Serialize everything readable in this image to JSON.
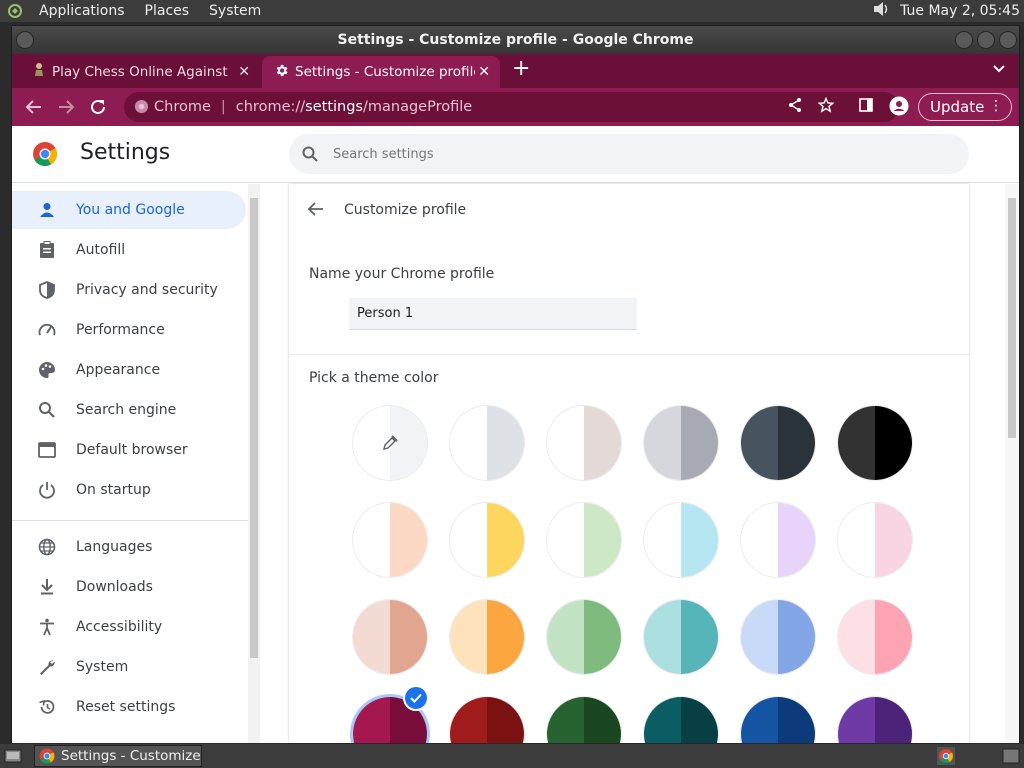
{
  "panel": {
    "menus": [
      "Applications",
      "Places",
      "System"
    ],
    "clock": "Tue May  2, 05:45"
  },
  "window": {
    "title": "Settings - Customize profile - Google Chrome"
  },
  "tabs": [
    {
      "title": "Play Chess Online Against the Computer",
      "active": false
    },
    {
      "title": "Settings - Customize profile",
      "active": true
    }
  ],
  "toolbar": {
    "omnibox_chrome": "Chrome",
    "omnibox_sep": "|",
    "url_scheme": "chrome://",
    "url_host": "settings",
    "url_path": "/manageProfile",
    "update_label": "Update"
  },
  "settings": {
    "title": "Settings",
    "search_placeholder": "Search settings",
    "nav": [
      {
        "label": "You and Google",
        "icon": "person-icon",
        "active": true
      },
      {
        "label": "Autofill",
        "icon": "clipboard-icon"
      },
      {
        "label": "Privacy and security",
        "icon": "shield-icon"
      },
      {
        "label": "Performance",
        "icon": "speedometer-icon"
      },
      {
        "label": "Appearance",
        "icon": "palette-icon"
      },
      {
        "label": "Search engine",
        "icon": "search-icon"
      },
      {
        "label": "Default browser",
        "icon": "browser-icon"
      },
      {
        "label": "On startup",
        "icon": "power-icon"
      },
      {
        "label": "Languages",
        "icon": "globe-icon"
      },
      {
        "label": "Downloads",
        "icon": "download-icon"
      },
      {
        "label": "Accessibility",
        "icon": "accessibility-icon"
      },
      {
        "label": "System",
        "icon": "wrench-icon"
      },
      {
        "label": "Reset settings",
        "icon": "restore-icon"
      }
    ]
  },
  "customize": {
    "title": "Customize profile",
    "name_label": "Name your Chrome profile",
    "name_value": "Person 1",
    "theme_label": "Pick a theme color",
    "swatches": [
      [
        [
          "#ffffff",
          "#f1f3f4"
        ],
        [
          "#ffffff",
          "#dee1e6"
        ],
        [
          "#ffffff",
          "#e3d9d7"
        ],
        [
          "#d6d7dc",
          "#a8aab3"
        ],
        [
          "#47535e",
          "#2a323a"
        ],
        [
          "#323232",
          "#000000"
        ]
      ],
      [
        [
          "#ffffff",
          "#fcd9c4"
        ],
        [
          "#ffffff",
          "#fdd65f"
        ],
        [
          "#ffffff",
          "#cde8c4"
        ],
        [
          "#ffffff",
          "#b6e6f1"
        ],
        [
          "#ffffff",
          "#e8d3fb"
        ],
        [
          "#ffffff",
          "#f9d4e3"
        ]
      ],
      [
        [
          "#f3dbd3",
          "#e2a590"
        ],
        [
          "#fde2bb",
          "#fca63f"
        ],
        [
          "#c3e4c4",
          "#7fbb7f"
        ],
        [
          "#acdfe0",
          "#56b5b9"
        ],
        [
          "#c9daf8",
          "#83a6e6"
        ],
        [
          "#fde0e5",
          "#fca4b4"
        ]
      ],
      [
        [
          "#a5174f",
          "#7a0e3b"
        ],
        [
          "#a01c1c",
          "#7a1212"
        ],
        [
          "#276231",
          "#1a4622"
        ],
        [
          "#0a5d63",
          "#073f44"
        ],
        [
          "#1655a3",
          "#0d3a7a"
        ],
        [
          "#6f3aa6",
          "#4c2378"
        ]
      ]
    ],
    "selected_row": 3,
    "selected_col": 0
  },
  "taskbar": {
    "item_label": "Settings - Customize..."
  }
}
